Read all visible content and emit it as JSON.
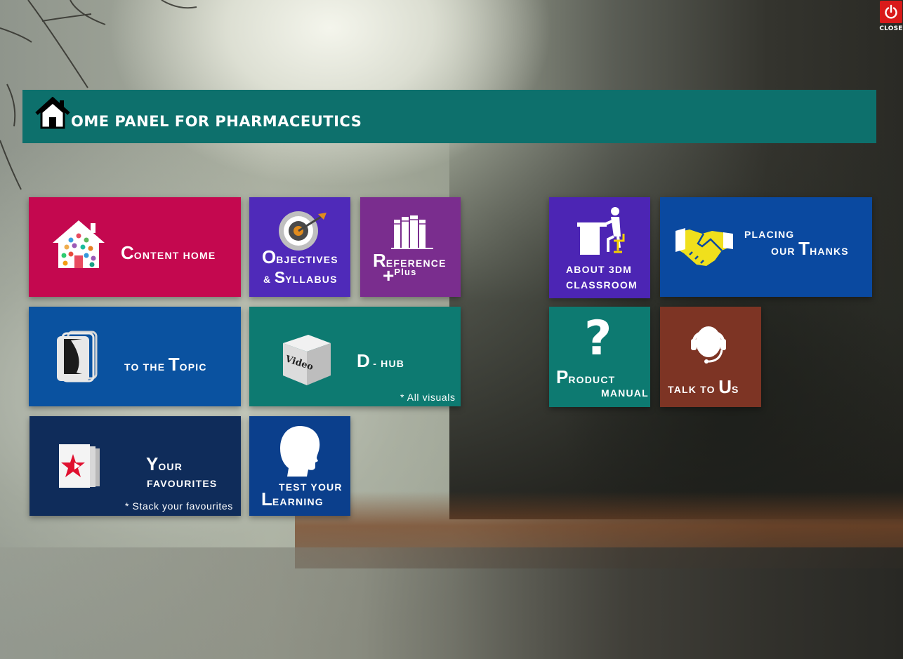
{
  "window": {
    "close_label": "CLOSE"
  },
  "header": {
    "title_first_letter_icon": "home-icon",
    "title": "OME PANEL  FOR  PHARMACEUTICS"
  },
  "tiles": {
    "content_home": {
      "cap": "C",
      "rest": "ONTENT HOME",
      "color": "#c4084f"
    },
    "objectives": {
      "cap1": "O",
      "rest1": "BJECTIVES",
      "amp": "&",
      "cap2": "S",
      "rest2": "YLLABUS",
      "color": "#4f2ab9"
    },
    "reference": {
      "cap": "R",
      "rest": "EFERENCE",
      "plus_sign": "+",
      "plus_word": "Plus",
      "color": "#7a2d8e"
    },
    "to_topic": {
      "pre": "TO THE",
      "cap": "T",
      "rest": "OPIC",
      "color": "#0a52a0"
    },
    "d_hub": {
      "cap": "D",
      "rest": "- HUB",
      "note": "* All visuals",
      "box_label": "Video",
      "color": "#0d7a71"
    },
    "favourites": {
      "cap": "Y",
      "rest": "OUR",
      "line2": "FAVOURITES",
      "note": "* Stack your favourites",
      "color": "#0f2c5a"
    },
    "test_learning": {
      "line1": "TEST YOUR",
      "cap": "L",
      "rest": "EARNING",
      "color": "#0b3f8c"
    },
    "about_3dm": {
      "line1": "ABOUT 3DM",
      "line2": "CLASSROOM",
      "color": "#4c25b4"
    },
    "thanks": {
      "line1": "PLACING",
      "pre": "OUR",
      "cap": "T",
      "rest": "HANKS",
      "color": "#0a49a0"
    },
    "product_manual": {
      "cap": "P",
      "rest": "RODUCT",
      "line2": "MANUAL",
      "color": "#0d7a71"
    },
    "talk_to_us": {
      "pre": "TALK TO",
      "cap": "U",
      "rest": "S",
      "color": "#7d3424"
    }
  }
}
